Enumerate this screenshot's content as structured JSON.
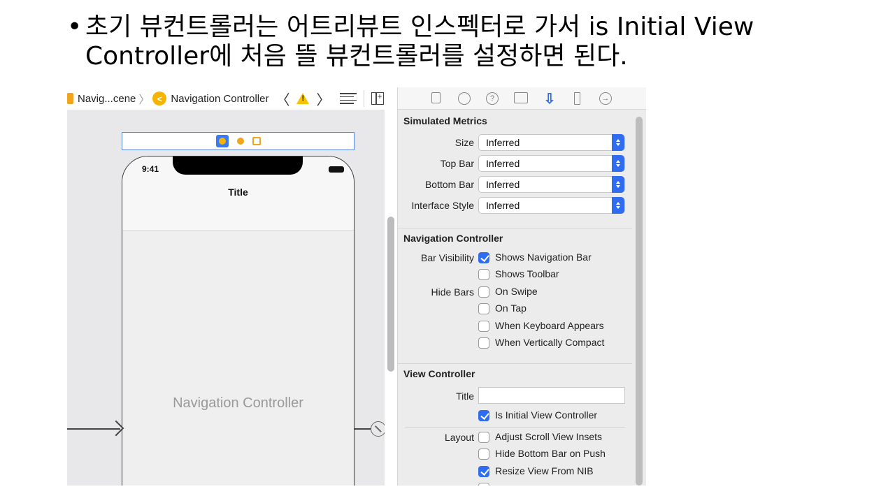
{
  "slide": {
    "bullet": "•",
    "line1": "초기 뷰컨트롤러는 어트리뷰트 인스펙터로 가서 is Initial View",
    "line2": "Controller에 처음 뜰 뷰컨트롤러를 설정하면 된다."
  },
  "jumpbar": {
    "scene_label": "Navig...cene",
    "separator": "〉",
    "controller_label": "Navigation Controller",
    "back_glyph": "〈",
    "forward_glyph": "〉"
  },
  "canvas": {
    "status_time": "9:41",
    "nav_title": "Title",
    "scene_label": "Navigation Controller"
  },
  "inspector": {
    "simulated_metrics": {
      "title": "Simulated Metrics",
      "rows": [
        {
          "label": "Size",
          "value": "Inferred"
        },
        {
          "label": "Top Bar",
          "value": "Inferred"
        },
        {
          "label": "Bottom Bar",
          "value": "Inferred"
        },
        {
          "label": "Interface Style",
          "value": "Inferred"
        }
      ]
    },
    "navigation_controller": {
      "title": "Navigation Controller",
      "bar_visibility_label": "Bar Visibility",
      "hide_bars_label": "Hide Bars",
      "options": [
        {
          "label": "Shows Navigation Bar",
          "checked": true
        },
        {
          "label": "Shows Toolbar",
          "checked": false
        },
        {
          "label": "On Swipe",
          "checked": false
        },
        {
          "label": "On Tap",
          "checked": false
        },
        {
          "label": "When Keyboard Appears",
          "checked": false
        },
        {
          "label": "When Vertically Compact",
          "checked": false
        }
      ]
    },
    "view_controller": {
      "title": "View Controller",
      "title_field_label": "Title",
      "title_field_value": "",
      "initial_label": "Is Initial View Controller",
      "initial_checked": true,
      "layout_label": "Layout",
      "layout_options": [
        {
          "label": "Adjust Scroll View Insets",
          "checked": false
        },
        {
          "label": "Hide Bottom Bar on Push",
          "checked": false
        },
        {
          "label": "Resize View From NIB",
          "checked": true
        }
      ]
    }
  },
  "colors": {
    "accent": "#2f6cf0",
    "warning": "#f5c400",
    "scene_icon": "#f2a51c"
  }
}
